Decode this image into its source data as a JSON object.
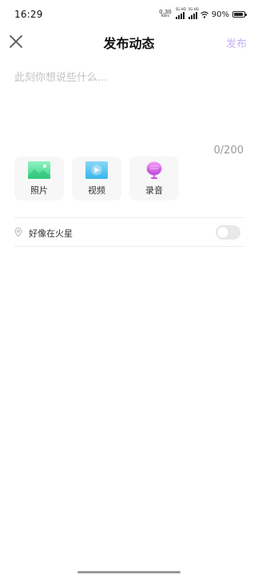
{
  "status_bar": {
    "time": "16:29",
    "net_speed": "0.30",
    "net_unit": "KB/s",
    "sim1_label": "5G HD",
    "sim2_label": "5G HD",
    "battery_percent": "90%",
    "icons": [
      "signal-icon",
      "signal-icon",
      "wifi-icon",
      "battery-icon"
    ]
  },
  "header": {
    "title": "发布动态",
    "publish_label": "发布",
    "publish_color": "#c4b3f2",
    "close_icon": "close-icon"
  },
  "editor": {
    "placeholder": "此刻你想说些什么...",
    "value": "",
    "char_count": "0/200"
  },
  "media_buttons": [
    {
      "label": "照片",
      "icon": "photo-icon",
      "color": "#5fe3a1"
    },
    {
      "label": "视频",
      "icon": "video-icon",
      "color": "#4fc3f2"
    },
    {
      "label": "录音",
      "icon": "microphone-icon",
      "color": "#d86be8"
    }
  ],
  "location": {
    "label": "好像在火星",
    "icon": "location-pin-icon",
    "toggle_on": false
  }
}
